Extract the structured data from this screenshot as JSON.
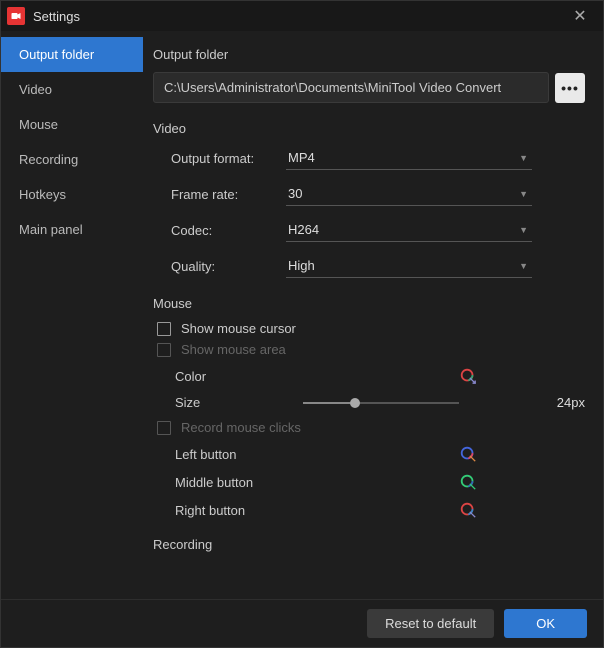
{
  "window": {
    "title": "Settings"
  },
  "sidebar": {
    "items": [
      {
        "label": "Output folder",
        "active": true
      },
      {
        "label": "Video"
      },
      {
        "label": "Mouse"
      },
      {
        "label": "Recording"
      },
      {
        "label": "Hotkeys"
      },
      {
        "label": "Main panel"
      }
    ]
  },
  "output_folder": {
    "heading": "Output folder",
    "path": "C:\\Users\\Administrator\\Documents\\MiniTool Video Convert",
    "browse_label": "•••"
  },
  "video": {
    "heading": "Video",
    "output_format": {
      "label": "Output format:",
      "value": "MP4"
    },
    "frame_rate": {
      "label": "Frame rate:",
      "value": "30"
    },
    "codec": {
      "label": "Codec:",
      "value": "H264"
    },
    "quality": {
      "label": "Quality:",
      "value": "High"
    }
  },
  "mouse": {
    "heading": "Mouse",
    "show_cursor": {
      "label": "Show mouse cursor",
      "checked": false
    },
    "show_area": {
      "label": "Show mouse area",
      "disabled": true
    },
    "color_label": "Color",
    "size_label": "Size",
    "size_value": "24px",
    "record_clicks": {
      "label": "Record mouse clicks",
      "disabled": true
    },
    "left_label": "Left button",
    "middle_label": "Middle button",
    "right_label": "Right button"
  },
  "recording": {
    "heading": "Recording"
  },
  "footer": {
    "reset": "Reset to default",
    "ok": "OK"
  },
  "colors": {
    "accent": "#2e77d0",
    "app_icon_bg": "#e63434"
  }
}
